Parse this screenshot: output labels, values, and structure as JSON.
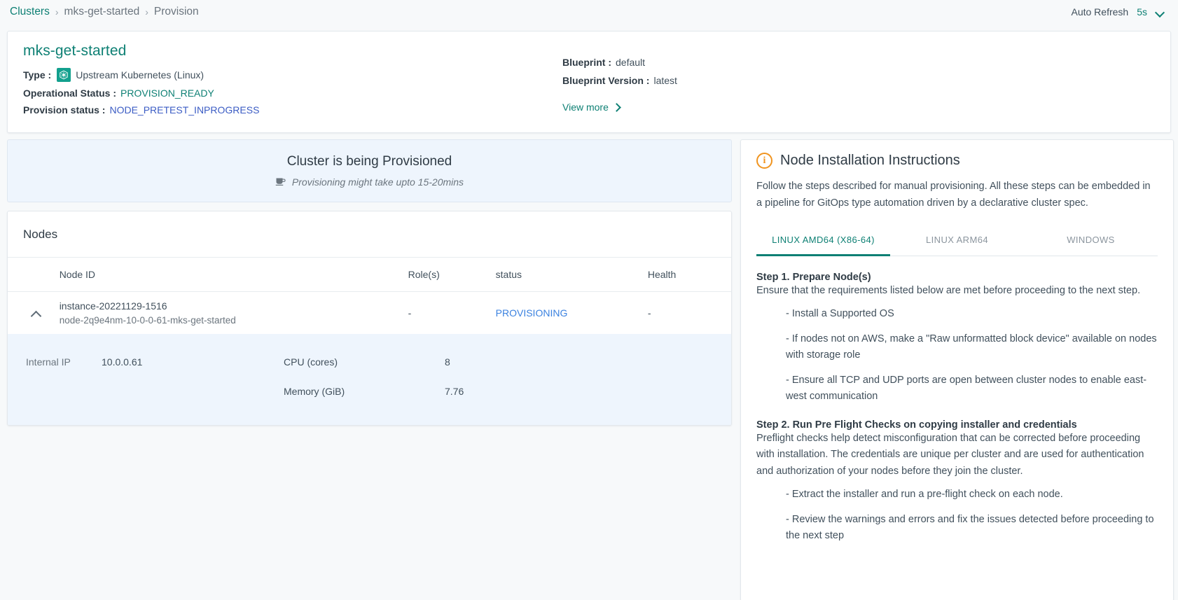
{
  "breadcrumb": {
    "items": [
      {
        "label": "Clusters",
        "link": true
      },
      {
        "label": "mks-get-started",
        "link": false
      },
      {
        "label": "Provision",
        "link": false
      }
    ],
    "separator": "›"
  },
  "topbar": {
    "auto_refresh_label": "Auto Refresh",
    "auto_refresh_value": "5s",
    "chevron_icon": "chevron-down-icon"
  },
  "cluster": {
    "name": "mks-get-started",
    "type_label": "Type :",
    "type_value": "Upstream Kubernetes (Linux)",
    "type_icon": "kubernetes-icon",
    "operational_status_label": "Operational Status :",
    "operational_status_value": "PROVISION_READY",
    "provision_status_label": "Provision status :",
    "provision_status_value": "NODE_PRETEST_INPROGRESS",
    "blueprint_label": "Blueprint :",
    "blueprint_value": "default",
    "blueprint_version_label": "Blueprint Version :",
    "blueprint_version_value": "latest",
    "view_more_label": "View more"
  },
  "banner": {
    "title": "Cluster is being Provisioned",
    "subtitle": "Provisioning might take upto 15-20mins",
    "icon": "coffee-cup-icon"
  },
  "nodes": {
    "panel_title": "Nodes",
    "columns": [
      "",
      "Node ID",
      "Role(s)",
      "status",
      "Health"
    ],
    "rows": [
      {
        "node_id": "instance-20221129-1516",
        "node_name": "node-2q9e4nm-10-0-0-61-mks-get-started",
        "roles": "-",
        "status": "PROVISIONING",
        "health": "-",
        "expanded": true,
        "details": {
          "internal_ip_label": "Internal IP",
          "internal_ip_value": "10.0.0.61",
          "cpu_label": "CPU (cores)",
          "cpu_value": "8",
          "memory_label": "Memory (GiB)",
          "memory_value": "7.76"
        }
      }
    ]
  },
  "instructions": {
    "title": "Node Installation Instructions",
    "icon": "info-circle-icon",
    "intro": "Follow the steps described for manual provisioning. All these steps can be embedded in a pipeline for GitOps type automation driven by a declarative cluster spec.",
    "tabs": [
      {
        "label": "LINUX AMD64 (X86-64)",
        "active": true
      },
      {
        "label": "LINUX ARM64",
        "active": false
      },
      {
        "label": "WINDOWS",
        "active": false
      }
    ],
    "steps": [
      {
        "title": "Step 1. Prepare Node(s)",
        "body": "Ensure that the requirements listed below are met before proceeding to the next step.",
        "bullets": [
          "- Install a Supported OS",
          "- If nodes not on AWS, make a \"Raw unformatted block device\" available on nodes with storage role",
          "- Ensure all TCP and UDP ports are open between cluster nodes to enable east-west communication"
        ]
      },
      {
        "title": "Step 2. Run Pre Flight Checks on copying installer and credentials",
        "body": "Preflight checks help detect misconfiguration that can be corrected before proceeding with installation. The credentials are unique per cluster and are used for authentication and authorization of your nodes before they join the cluster.",
        "bullets": [
          "- Extract the installer and run a pre-flight check on each node.",
          "- Review the warnings and errors and fix the issues detected before proceeding to the next step"
        ]
      }
    ]
  },
  "colors": {
    "accent_teal": "#0e8074",
    "status_blue": "#3b82e0",
    "provision_status_blue": "#3b5cc4",
    "info_orange": "#f0941f",
    "banner_bg": "#eef5fd"
  }
}
